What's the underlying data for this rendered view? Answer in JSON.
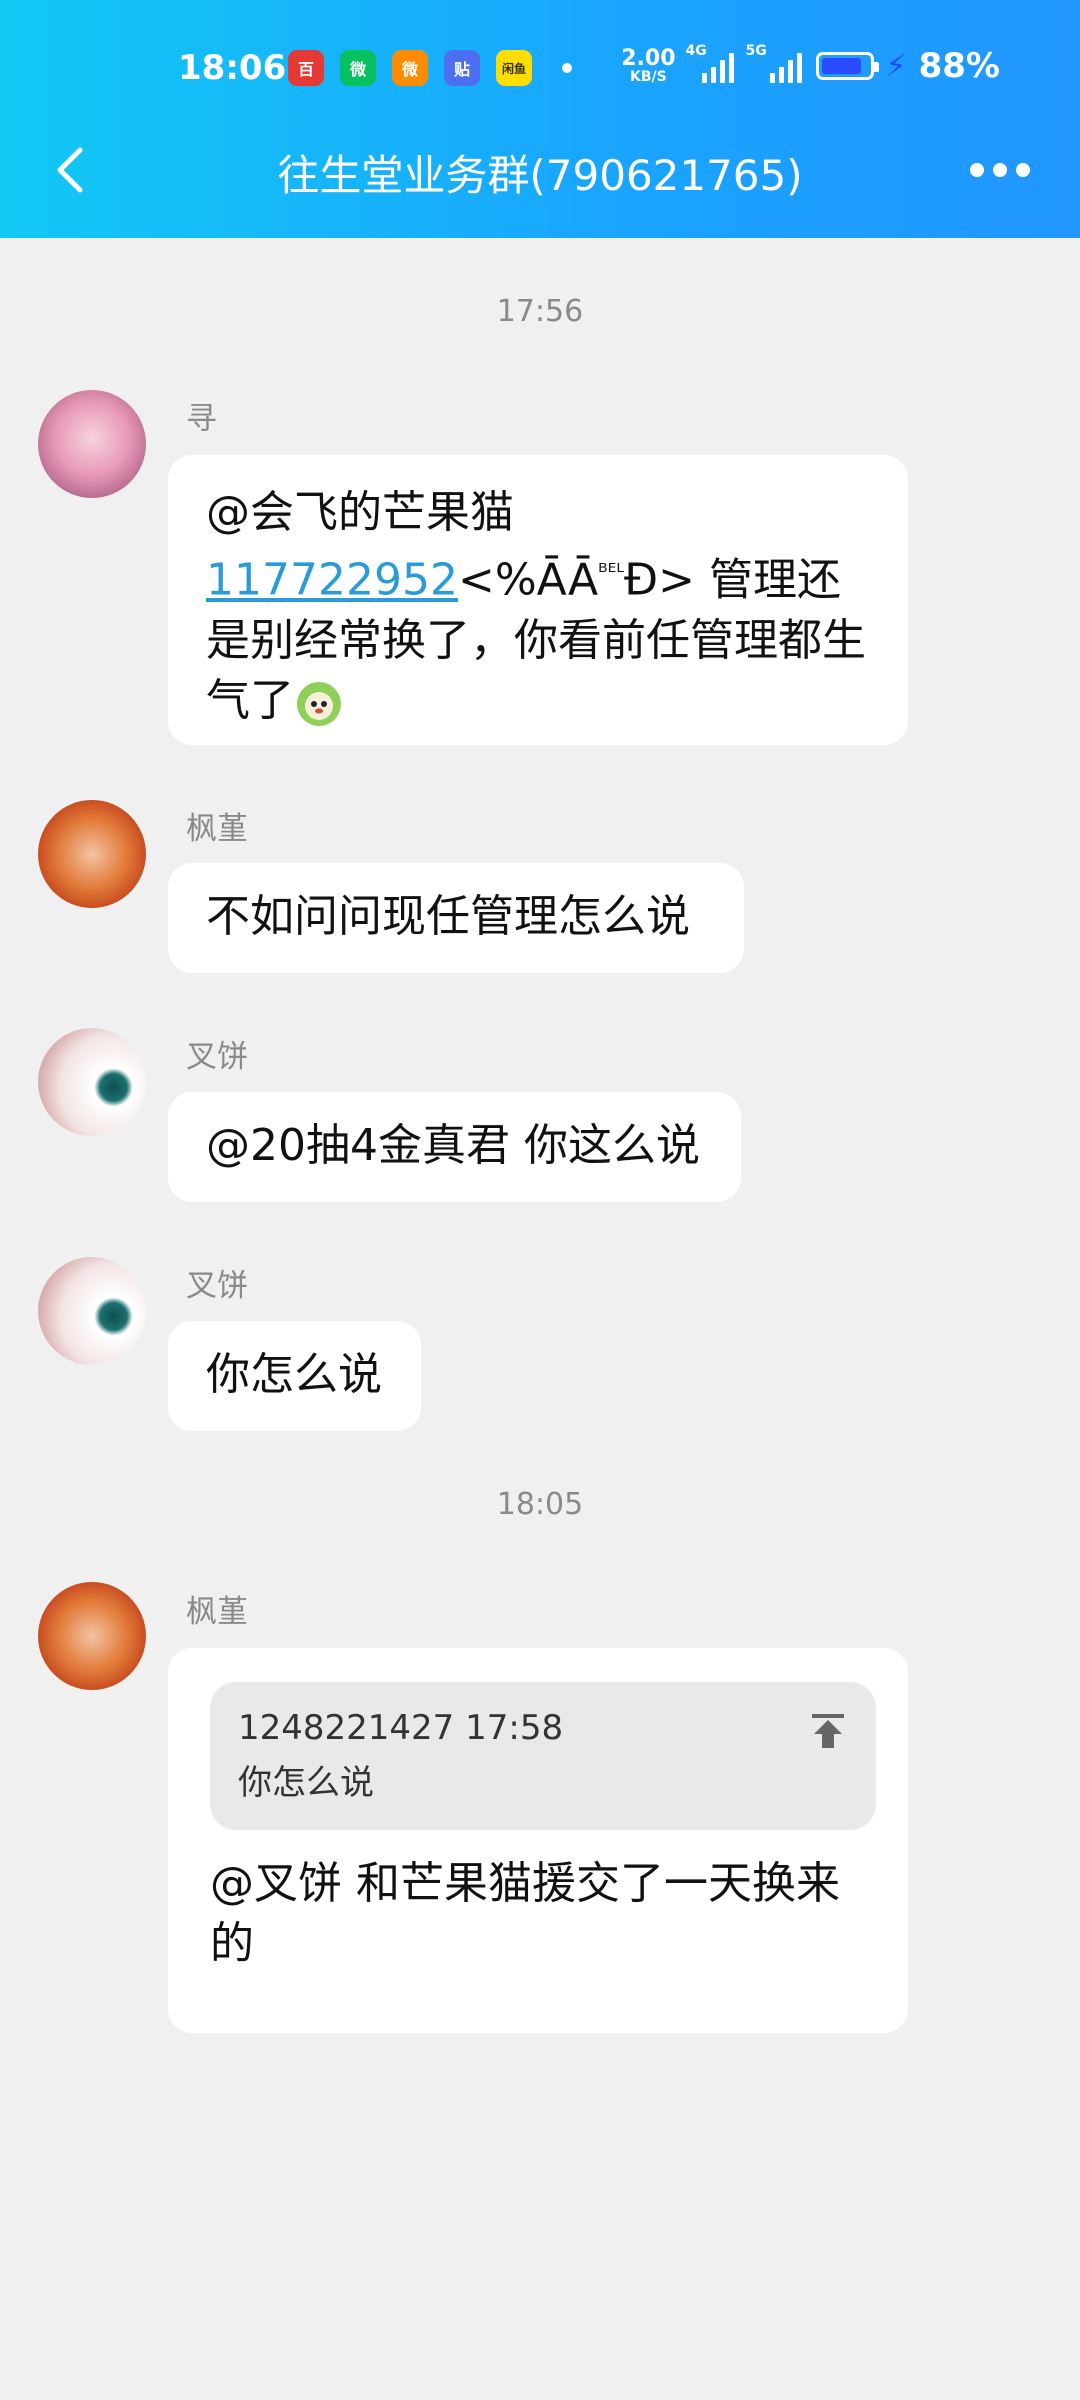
{
  "status_bar": {
    "time": "18:06",
    "apps": [
      {
        "icon": "baidu-icon",
        "text": "百",
        "color": "#e53935"
      },
      {
        "icon": "wechat-icon",
        "text": "微",
        "color": "#07c160"
      },
      {
        "icon": "weibo-icon",
        "text": "微",
        "color": "#ff8c00"
      },
      {
        "icon": "tieba-icon",
        "text": "贴",
        "color": "#4e6ef2"
      },
      {
        "icon": "xianyu-icon",
        "text": "闲鱼",
        "color": "#ffdd00"
      }
    ],
    "speed_value": "2.00",
    "speed_unit": "KB/S",
    "sig1_label": "4G",
    "sig2_label": "5G",
    "battery_percent": "88%",
    "battery_level": 0.88,
    "bolt_color": "#1f4bff"
  },
  "header": {
    "title": "往生堂业务群(790621765)"
  },
  "timestamps": [
    "17:56",
    "18:05"
  ],
  "messages": [
    {
      "sender": "寻",
      "mention": "@会飞的芒果猫",
      "link": "117722952",
      "tail_pre": "<%ĀĀ",
      "tail_small": "ᴮᴱᴸ",
      "tail_post": "Đ> 管理还是别经常换了，你看前任管理都生气了",
      "emoji": "sprout-face-emoji"
    },
    {
      "sender": "枫堇",
      "text": "不如问问现任管理怎么说"
    },
    {
      "sender": "叉饼",
      "text": "@20抽4金真君 你这么说"
    },
    {
      "sender": "叉饼",
      "text": "你怎么说"
    },
    {
      "sender": "枫堇",
      "quote_meta": "1248221427 17:58",
      "quote_text": "你怎么说",
      "text": "@叉饼 和芒果猫援交了一天换来的"
    }
  ]
}
